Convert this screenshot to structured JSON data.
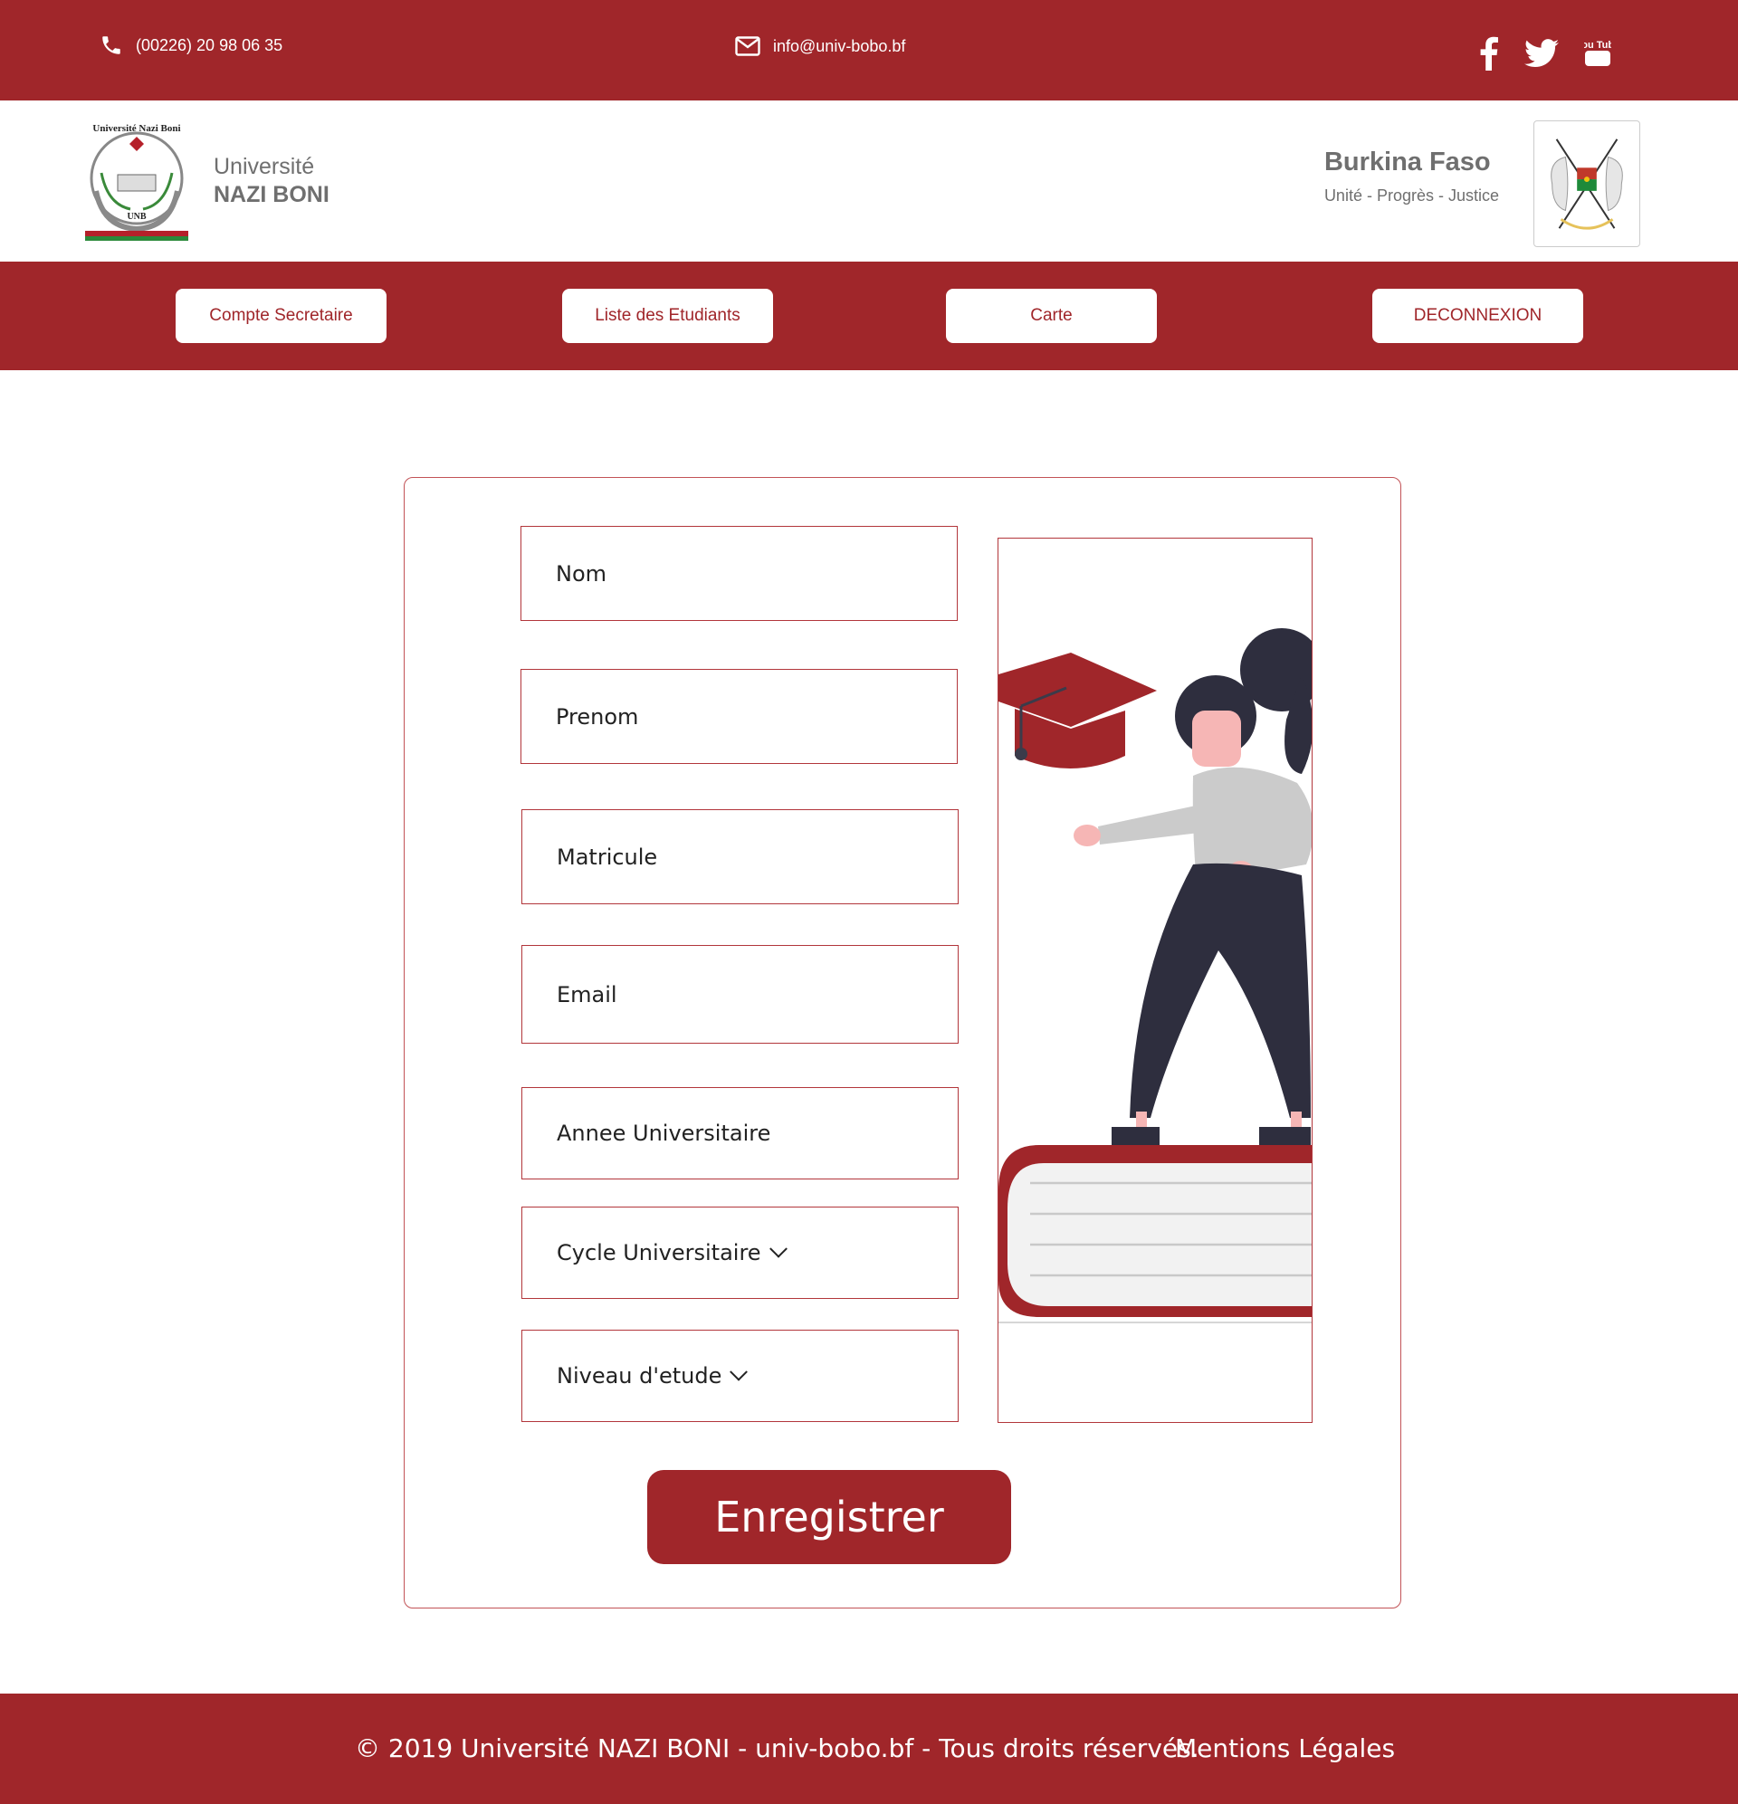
{
  "topbar": {
    "phone": "(00226) 20 98 06 35",
    "email": "info@univ-bobo.bf",
    "social_icons": [
      "facebook-icon",
      "twitter-icon",
      "youtube-icon"
    ],
    "youtube_logo_text": "You Tube"
  },
  "brand": {
    "university_line1": "Université",
    "university_line2": "NAZI BONI",
    "logo_text_top": "Université Nazi Boni",
    "logo_text_bottom": "UNB",
    "country": "Burkina Faso",
    "motto": "Unité - Progrès - Justice"
  },
  "nav": {
    "items": [
      {
        "label": "Compte Secretaire"
      },
      {
        "label": "Liste des Etudiants"
      },
      {
        "label": "Carte"
      },
      {
        "label": "DECONNEXION"
      }
    ]
  },
  "form": {
    "fields": {
      "nom": "Nom",
      "prenom": "Prenom",
      "matricule": "Matricule",
      "email": "Email",
      "annee": "Annee Universitaire",
      "cycle": "Cycle Universitaire",
      "niveau": "Niveau d'etude"
    },
    "submit_label": "Enregistrer"
  },
  "footer": {
    "copyright": "© 2019 Université NAZI BONI - univ-bobo.bf - Tous droits réservés.",
    "legal": "Mentions Légales"
  },
  "colors": {
    "brand_red": "#a0262a",
    "text_gray": "#6f6f6f",
    "border_red": "#b2363b"
  }
}
